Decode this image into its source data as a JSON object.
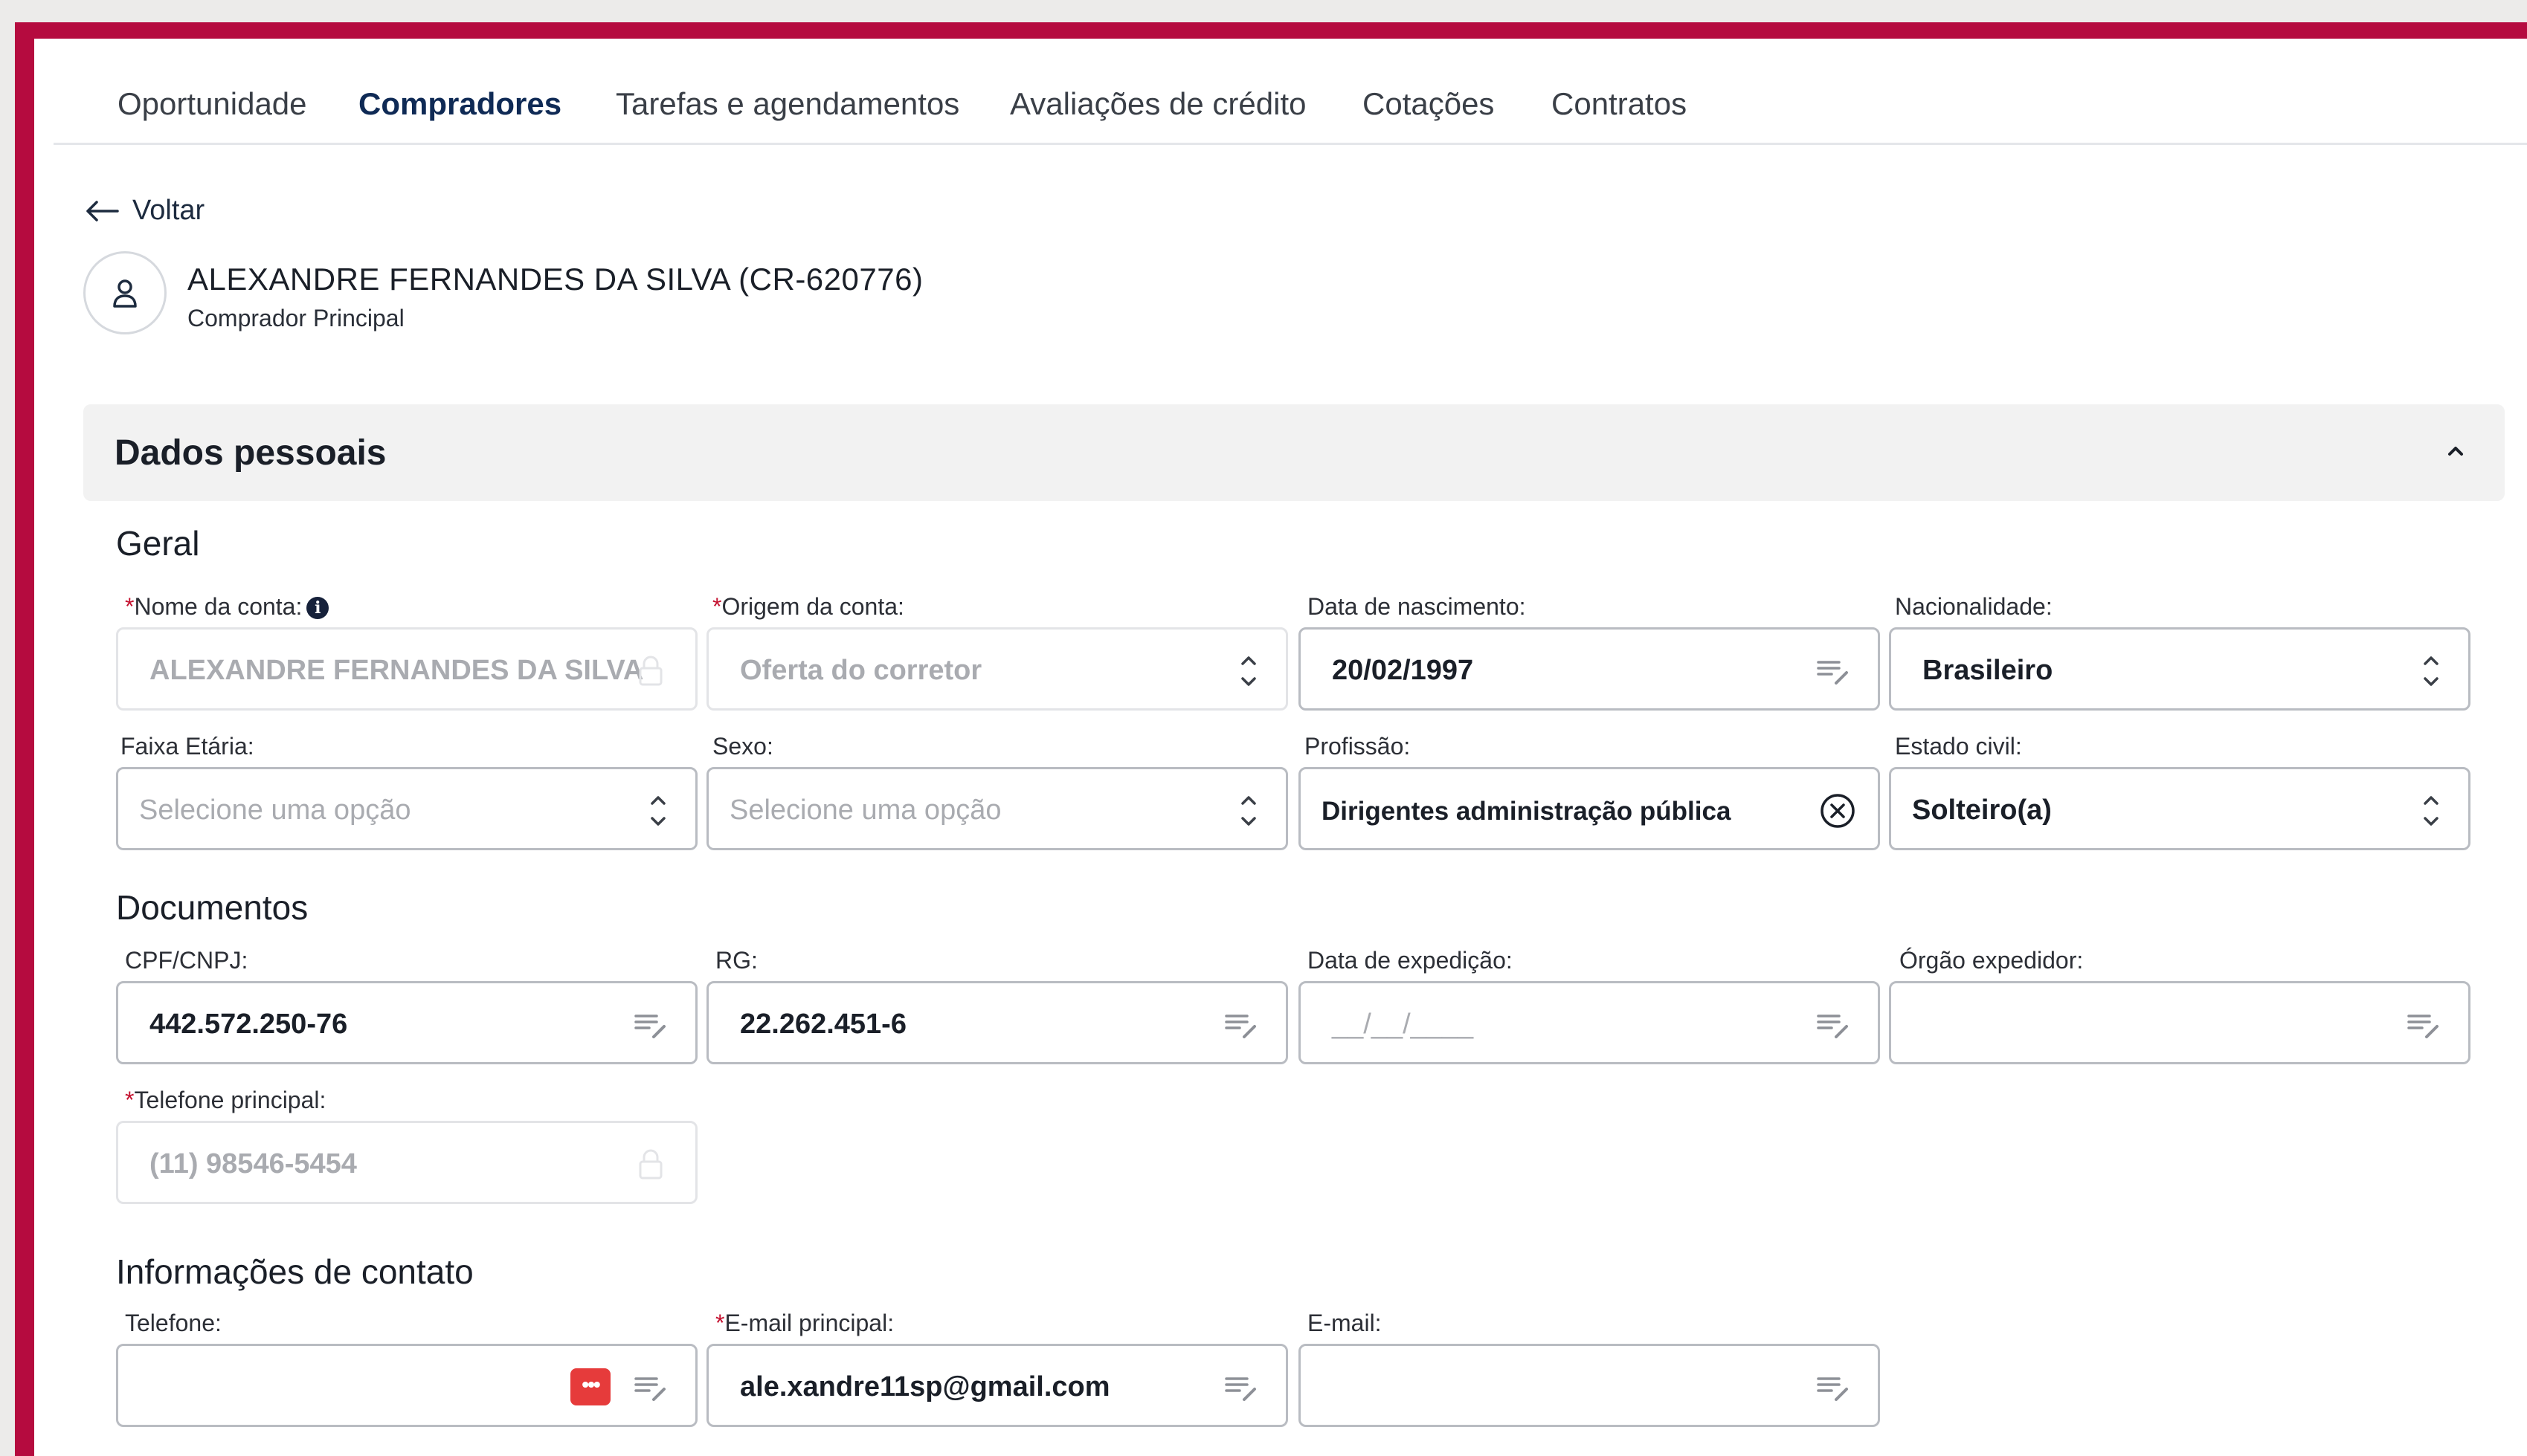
{
  "tabs": [
    "Oportunidade",
    "Compradores",
    "Tarefas e agendamentos",
    "Avaliações de crédito",
    "Cotações",
    "Contratos"
  ],
  "active_tab": "Compradores",
  "back_label": "Voltar",
  "buyer": {
    "name": "ALEXANDRE FERNANDES DA SILVA (CR-620776)",
    "role": "Comprador Principal"
  },
  "section": {
    "title": "Dados pessoais",
    "groups": {
      "geral": "Geral",
      "documentos": "Documentos",
      "contato": "Informações de contato"
    }
  },
  "fields": {
    "nome_conta": {
      "label": "Nome da conta:",
      "value": "ALEXANDRE FERNANDES DA SILVA"
    },
    "origem_conta": {
      "label": "Origem da conta:",
      "value": "Oferta do corretor"
    },
    "data_nascimento": {
      "label": "Data de nascimento:",
      "value": "20/02/1997"
    },
    "nacionalidade": {
      "label": "Nacionalidade:",
      "value": "Brasileiro"
    },
    "faixa_etaria": {
      "label": "Faixa Etária:",
      "placeholder": "Selecione uma opção"
    },
    "sexo": {
      "label": "Sexo:",
      "placeholder": "Selecione uma opção"
    },
    "profissao": {
      "label": "Profissão:",
      "value": "Dirigentes administração pública"
    },
    "estado_civil": {
      "label": "Estado civil:",
      "value": "Solteiro(a)"
    },
    "cpf_cnpj": {
      "label": "CPF/CNPJ:",
      "value": "442.572.250-76"
    },
    "rg": {
      "label": "RG:",
      "value": "22.262.451-6"
    },
    "data_expedicao": {
      "label": "Data de expedição:",
      "placeholder": "__/__/____"
    },
    "orgao_expedidor": {
      "label": "Órgão expedidor:",
      "value": ""
    },
    "telefone_principal": {
      "label": "Telefone principal:",
      "value": "(11) 98546-5454"
    },
    "telefone": {
      "label": "Telefone:",
      "value": ""
    },
    "email_principal": {
      "label": "E-mail principal:",
      "value": "ale.xandre11sp@gmail.com"
    },
    "email": {
      "label": "E-mail:",
      "value": ""
    }
  },
  "required_marker": "*",
  "info_icon_glyph": "i",
  "chip_glyph": "•••",
  "colors": {
    "brand_frame": "#b50b3f",
    "active_tab": "#0f2a55",
    "required": "#c41230",
    "chip": "#e63b3b"
  },
  "icons": [
    "arrow-left-icon",
    "user-icon",
    "chevron-up-icon",
    "info-icon",
    "lock-icon",
    "sort-icon",
    "edit-lines-icon",
    "clear-circle-icon",
    "password-manager-icon"
  ]
}
